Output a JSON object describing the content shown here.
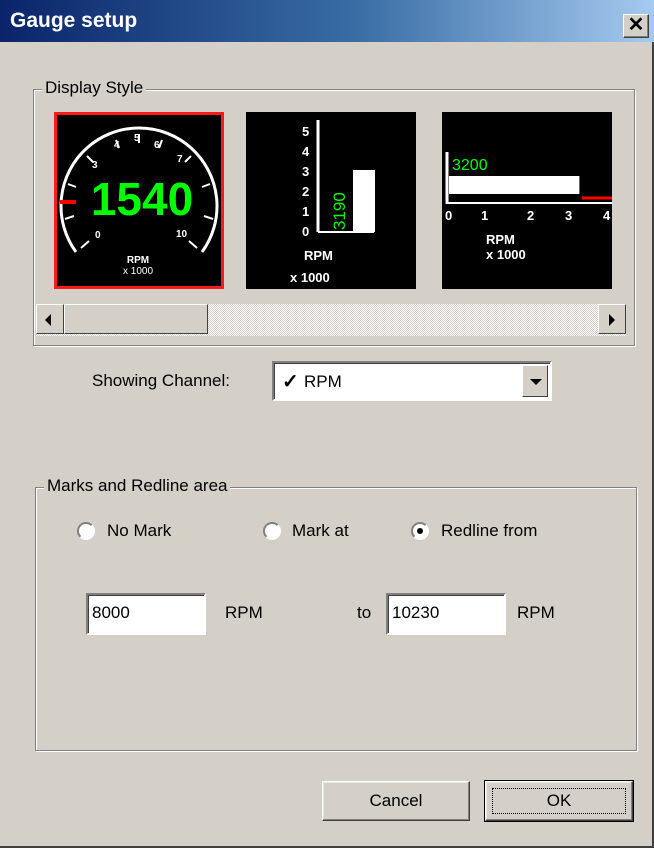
{
  "window": {
    "title": "Gauge setup",
    "close_glyph": "✕"
  },
  "display_style": {
    "legend": "Display Style",
    "styles": [
      {
        "name": "dial",
        "value": "1540",
        "ticks": [
          "0",
          "",
          "3",
          "4",
          "5",
          "6",
          "7",
          "",
          "10"
        ],
        "unit": "RPM",
        "scale": "x 1000",
        "selected": true
      },
      {
        "name": "vertical-bar",
        "value": "3190",
        "ticks": [
          "0",
          "1",
          "2",
          "3",
          "4",
          "5"
        ],
        "unit": "RPM",
        "scale": "x 1000",
        "fill": 0.62
      },
      {
        "name": "horizontal-bar",
        "value": "3200",
        "ticks": [
          "0",
          "1",
          "2",
          "3",
          "4"
        ],
        "unit": "RPM",
        "scale": "x 1000",
        "fill": 0.8
      }
    ]
  },
  "channel": {
    "label": "Showing Channel:",
    "check_glyph": "✓",
    "value": "RPM"
  },
  "marks": {
    "legend": "Marks and Redline area",
    "options": [
      {
        "label": "No Mark",
        "checked": false
      },
      {
        "label": "Mark at",
        "checked": false
      },
      {
        "label": "Redline from",
        "checked": true
      }
    ],
    "from_value": "8000",
    "from_unit": "RPM",
    "to_label": "to",
    "to_value": "10230",
    "to_unit": "RPM"
  },
  "buttons": {
    "cancel": "Cancel",
    "ok": "OK"
  },
  "colors": {
    "gauge_text": "#00ff00",
    "redline": "#ff0000",
    "title_start": "#0a246a",
    "title_end": "#a6caf0"
  }
}
